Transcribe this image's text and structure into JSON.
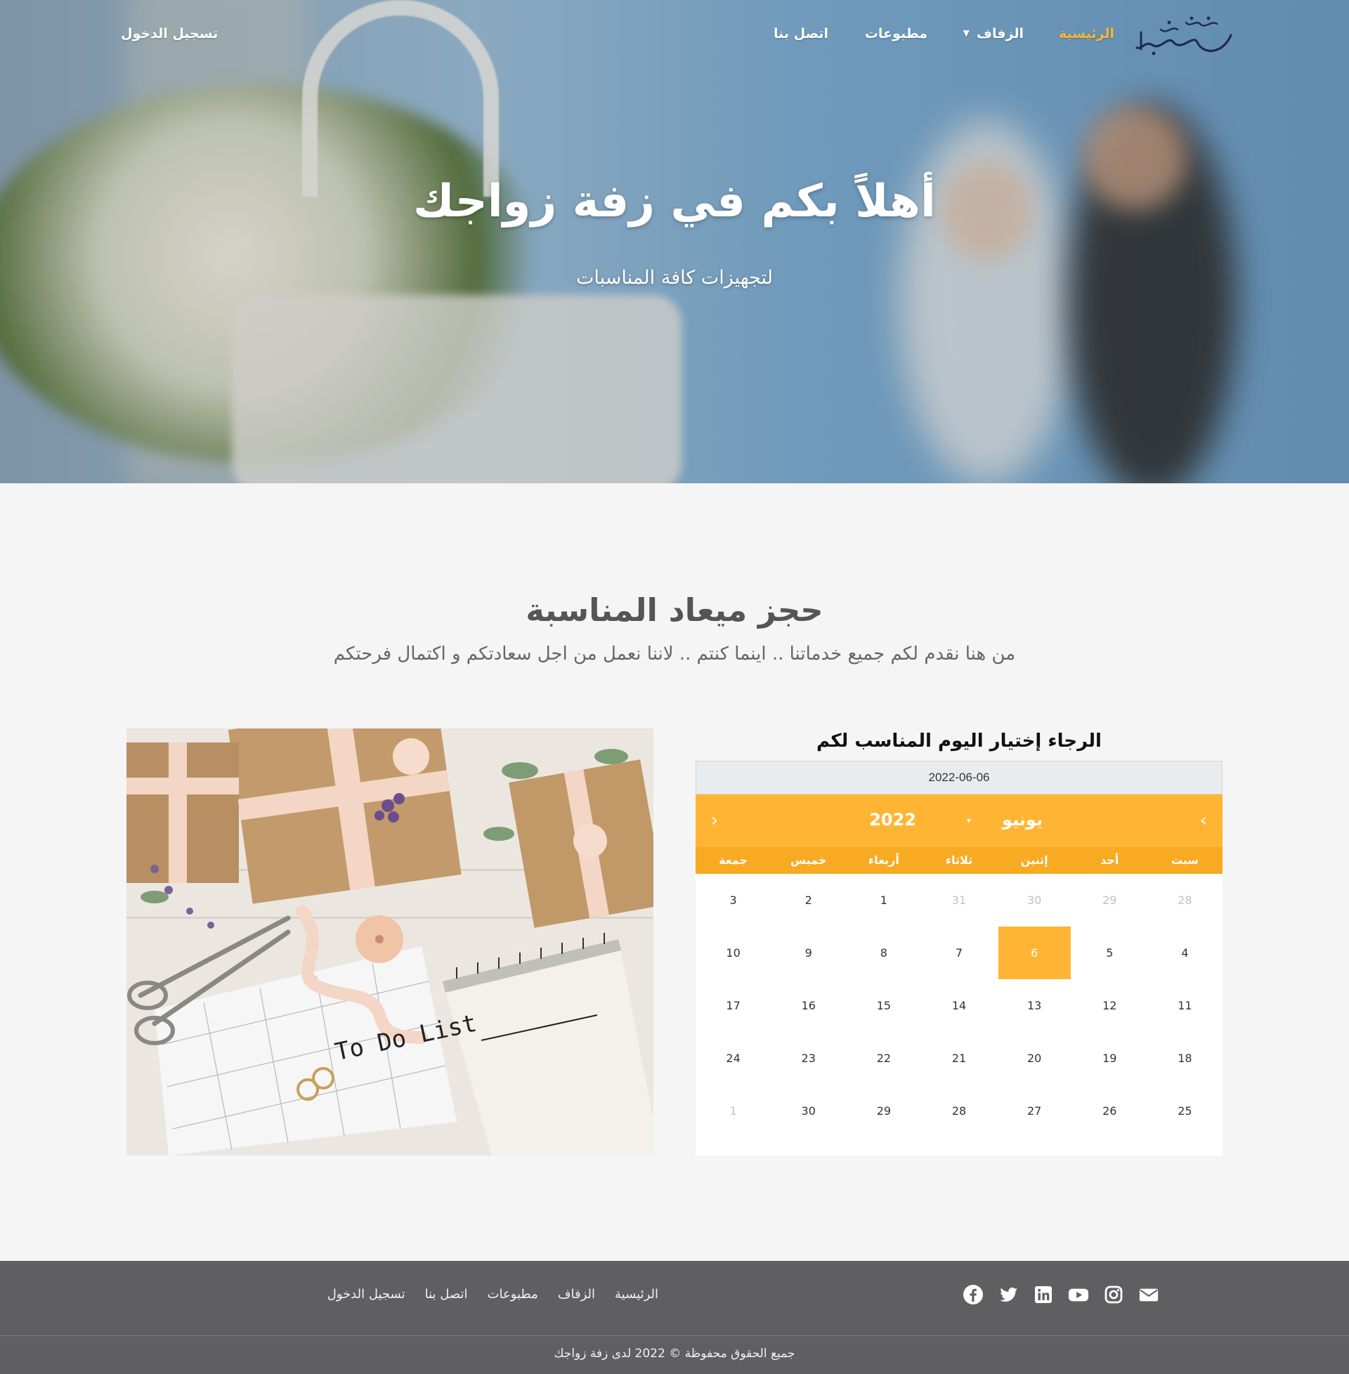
{
  "nav": {
    "logo_text": "زفة زواجك",
    "items": [
      {
        "label": "الرئيسية",
        "active": true
      },
      {
        "label": "الزفاف",
        "dropdown": true
      },
      {
        "label": "مطبوعات"
      },
      {
        "label": "اتصل بنا"
      }
    ],
    "login": "تسجيل الدخول"
  },
  "hero": {
    "title": "أهلاً بكم في زفة زواجك",
    "subtitle": "لتجهيزات كافة المناسبات"
  },
  "booking": {
    "title": "حجز ميعاد المناسبة",
    "subtitle": "من هنا نقدم لكم جميع خدماتنا .. اينما كنتم .. لاننا نعمل من اجل سعادتكم و اكتمال فرحتكم",
    "photo_note": "To Do List",
    "calendar": {
      "heading": "الرجاء إختيار اليوم المناسب لكم",
      "input_value": "2022-06-06",
      "month": "يونيو",
      "year": "2022",
      "weekdays": [
        "سبت",
        "أحد",
        "إثنين",
        "ثلاثاء",
        "أربعاء",
        "خميس",
        "جمعة"
      ],
      "weeks": [
        [
          "28",
          "29",
          "30",
          "31",
          "1",
          "2",
          "3"
        ],
        [
          "4",
          "5",
          "6",
          "7",
          "8",
          "9",
          "10"
        ],
        [
          "11",
          "12",
          "13",
          "14",
          "15",
          "16",
          "17"
        ],
        [
          "18",
          "19",
          "20",
          "21",
          "22",
          "23",
          "24"
        ],
        [
          "25",
          "26",
          "27",
          "28",
          "29",
          "30",
          "1"
        ]
      ],
      "selected_day": "6",
      "accent_color": "#ffb533"
    }
  },
  "footer": {
    "links": [
      "الرئيسية",
      "الزفاف",
      "مطبوعات",
      "اتصل بنا",
      "تسجيل الدخول"
    ],
    "social_icons": [
      "facebook-icon",
      "twitter-icon",
      "linkedin-icon",
      "youtube-icon",
      "instagram-icon",
      "envelope-icon"
    ],
    "copyright": "جميع الحقوق محفوظة © 2022 لدى زفة زواجك"
  },
  "colors": {
    "accent": "#f7b733",
    "footer_bg": "#5f5f61",
    "page_bg": "#f5f5f5"
  }
}
